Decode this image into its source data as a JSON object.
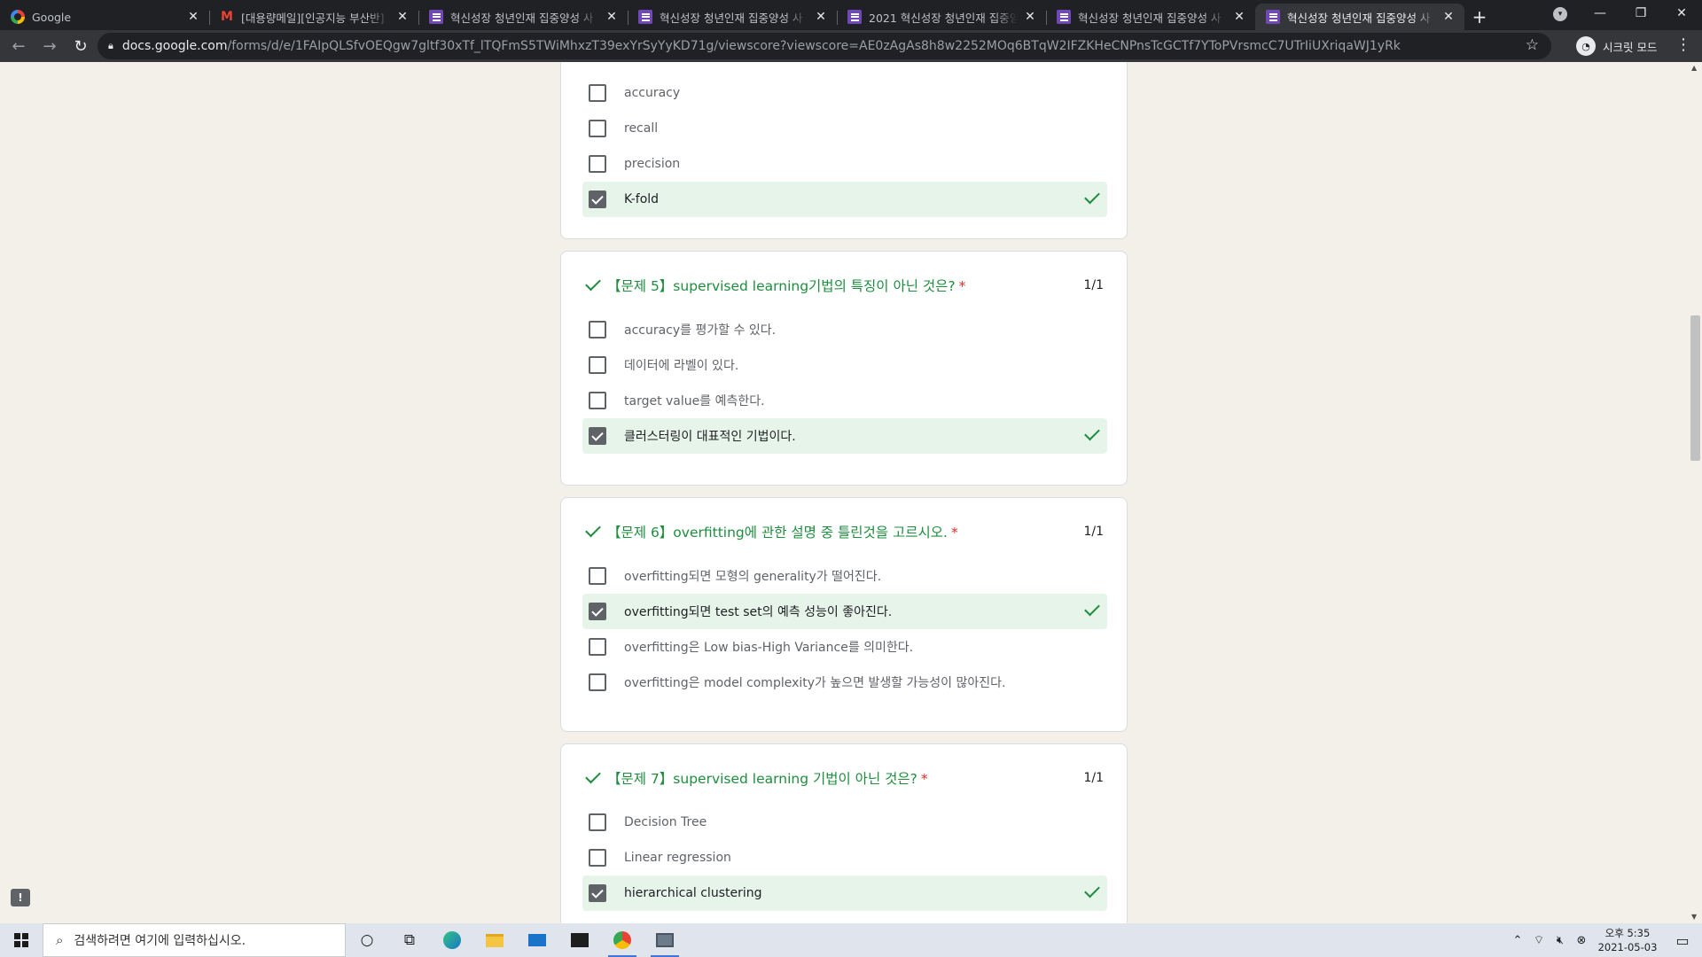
{
  "browser": {
    "tabs": [
      {
        "title": "Google",
        "icon": "google-icon"
      },
      {
        "title": "[대용량메일][인공지능 부산반] 2",
        "icon": "gmail-icon"
      },
      {
        "title": "혁신성장 청년인재 집중양성 사",
        "icon": "forms-icon"
      },
      {
        "title": "혁신성장 청년인재 집중양성 사",
        "icon": "forms-icon"
      },
      {
        "title": "2021 혁신성장 청년인재 집중양",
        "icon": "forms-icon"
      },
      {
        "title": "혁신성장 청년인재 집중양성 사",
        "icon": "forms-icon"
      },
      {
        "title": "혁신성장 청년인재 집중양성 사",
        "icon": "forms-icon",
        "active": true
      }
    ],
    "url_host": "docs.google.com",
    "url_path": "/forms/d/e/1FAIpQLSfvOEQgw7gltf30xTf_lTQFmS5TWiMhxzT39exYrSyYyKD71g/viewscore?viewscore=AE0zAgAs8h8w2252MOq6BTqW2IFZKHeCNPnsTcGCTf7YToPVrsmcC7UTrIiUXriqaWJ1yRk",
    "incognito_label": "시크릿 모드"
  },
  "questions": [
    {
      "title": "",
      "score": "",
      "options": [
        {
          "label": "accuracy",
          "checked": false
        },
        {
          "label": "recall",
          "checked": false
        },
        {
          "label": "precision",
          "checked": false
        },
        {
          "label": "K-fold",
          "checked": true
        }
      ]
    },
    {
      "title": "【문제 5】supervised learning기법의 특징이 아닌 것은?",
      "score": "1/1",
      "options": [
        {
          "label": "accuracy를 평가할 수 있다.",
          "checked": false
        },
        {
          "label": "데이터에 라벨이 있다.",
          "checked": false
        },
        {
          "label": "target value를 예측한다.",
          "checked": false
        },
        {
          "label": "클러스터링이 대표적인 기법이다.",
          "checked": true
        }
      ]
    },
    {
      "title": "【문제 6】overfitting에 관한 설명 중 틀린것을 고르시오.",
      "score": "1/1",
      "options": [
        {
          "label": "overfitting되면 모형의 generality가 떨어진다.",
          "checked": false
        },
        {
          "label": "overfitting되면 test set의 예측 성능이 좋아진다.",
          "checked": true
        },
        {
          "label": "overfitting은 Low bias-High Variance를 의미한다.",
          "checked": false
        },
        {
          "label": "overfitting은 model complexity가 높으면 발생할 가능성이 많아진다.",
          "checked": false
        }
      ]
    },
    {
      "title": "【문제 7】supervised learning 기법이 아닌 것은?",
      "score": "1/1",
      "options": [
        {
          "label": "Decision Tree",
          "checked": false
        },
        {
          "label": "Linear regression",
          "checked": false
        },
        {
          "label": "hierarchical clustering",
          "checked": true
        }
      ]
    }
  ],
  "required_mark": "*",
  "taskbar": {
    "search_placeholder": "검색하려면 여기에 입력하십시오.",
    "time": "오후 5:35",
    "date": "2021-05-03"
  },
  "colors": {
    "correct": "#1e8e3e",
    "selected_bg": "#e6f4ea",
    "page_bg": "#f3efe9"
  }
}
